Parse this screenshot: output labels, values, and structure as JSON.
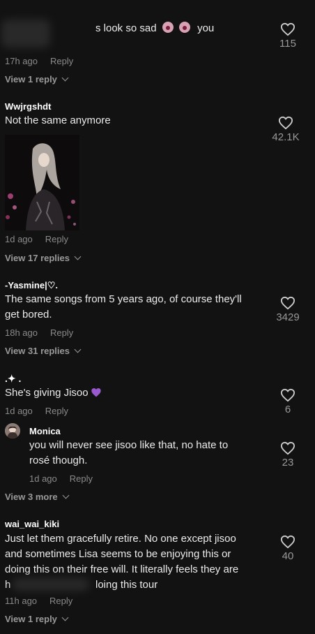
{
  "comments": [
    {
      "text_visible": "s look so sad",
      "text_end": "you",
      "time": "17h ago",
      "reply": "Reply",
      "view": "View 1 reply",
      "likes": "115"
    },
    {
      "username": "Wwjrgshdt",
      "text": "Not the same anymore",
      "time": "1d ago",
      "reply": "Reply",
      "view": "View 17 replies",
      "likes": "42.1K"
    },
    {
      "username": "-Yasmine|♡.",
      "text_line1": "The same songs from 5 years ago, of course they'll",
      "text_line2": "get bored.",
      "time": "18h ago",
      "reply": "Reply",
      "view": "View 31 replies",
      "likes": "3429"
    },
    {
      "username": ".✦ .",
      "text": "She's giving Jisoo",
      "time": "1d ago",
      "reply": "Reply",
      "likes": "6",
      "reply_item": {
        "username": "Monica",
        "text_line1": "you will never see jisoo like that, no hate to",
        "text_line2": "rosé though.",
        "time": "1d ago",
        "reply": "Reply",
        "likes": "23"
      },
      "view": "View 3 more"
    },
    {
      "username": "wai_wai_kiki",
      "text_line1": "Just let them gracefully retire. No one except jisoo",
      "text_line2": "and sometimes Lisa seems to be enjoying this or",
      "text_line3": "doing this on their free will. It literally feels they are",
      "text_line4_start": "h",
      "text_line4_end": "loing this tour",
      "time": "11h ago",
      "reply": "Reply",
      "view": "View 1 reply",
      "likes": "40"
    }
  ],
  "colors": {
    "background": "#121212",
    "muted": "#8a8a8a",
    "accent_emoji": "#9b59d0"
  },
  "icons": {
    "like": "heart-outline-icon",
    "expand": "chevron-down-icon",
    "emoji_heart": "purple-heart-icon",
    "emoji_face": "crying-face-icon"
  }
}
